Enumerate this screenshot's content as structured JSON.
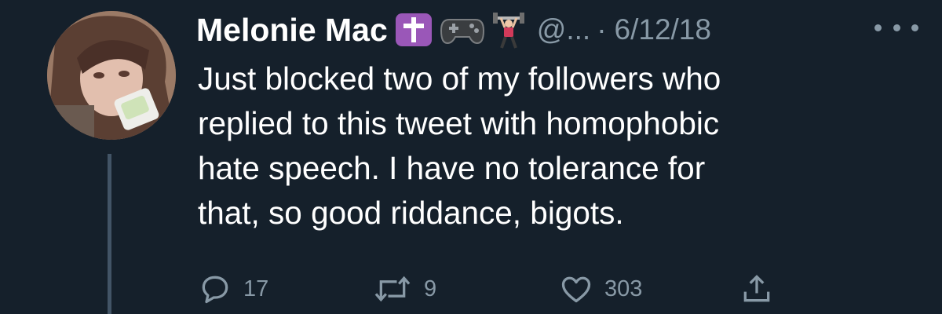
{
  "tweet": {
    "author_name": "Melonie Mac",
    "handle": "@...",
    "separator": "·",
    "date": "6/12/18",
    "text_lines": [
      "Just blocked two of my followers who",
      "replied to this tweet with homophobic",
      "hate speech. I have no tolerance for",
      "that, so good riddance, bigots."
    ],
    "badges": [
      "latin-cross-emoji",
      "video-game-controller-emoji",
      "weight-lifter-emoji"
    ],
    "stats": {
      "replies": "17",
      "retweets": "9",
      "likes": "303"
    }
  },
  "colors": {
    "background": "#15202b",
    "text": "#ffffff",
    "muted": "#8899a6",
    "thread_line": "#425466",
    "cross_badge": "#9a57b8"
  }
}
